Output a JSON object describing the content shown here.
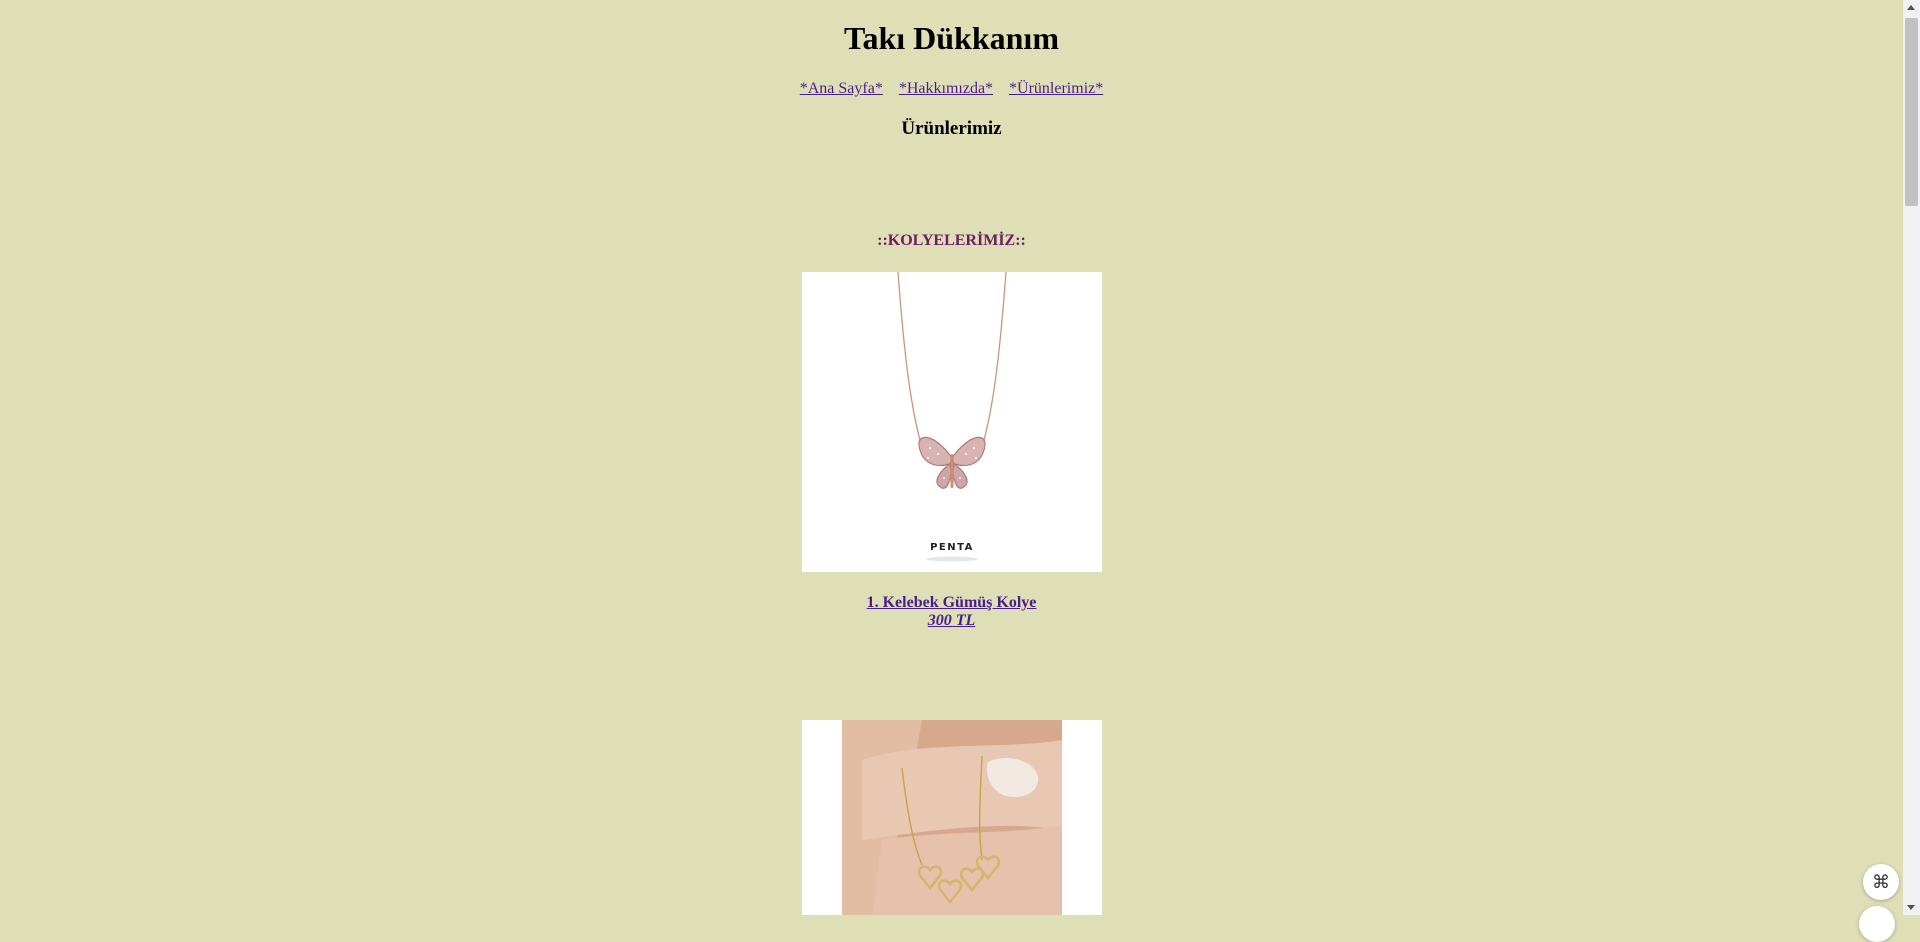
{
  "site": {
    "title": "Takı Dükkanım"
  },
  "nav": {
    "items": [
      {
        "label": "*Ana Sayfa*"
      },
      {
        "label": "*Hakkımızda*"
      },
      {
        "label": "*Ürünlerimiz*"
      }
    ]
  },
  "main": {
    "heading": "Ürünlerimiz",
    "category": "::KOLYELERİMİZ::",
    "products": [
      {
        "name": "1. Kelebek Gümüş Kolye",
        "price": "300 TL",
        "image_brand_text": "PENTA"
      }
    ]
  },
  "colors": {
    "background": "#dfdfb7",
    "link": "#4a1d8a",
    "category": "#6b1c63"
  },
  "icons": {
    "floating_button": "command-icon"
  }
}
